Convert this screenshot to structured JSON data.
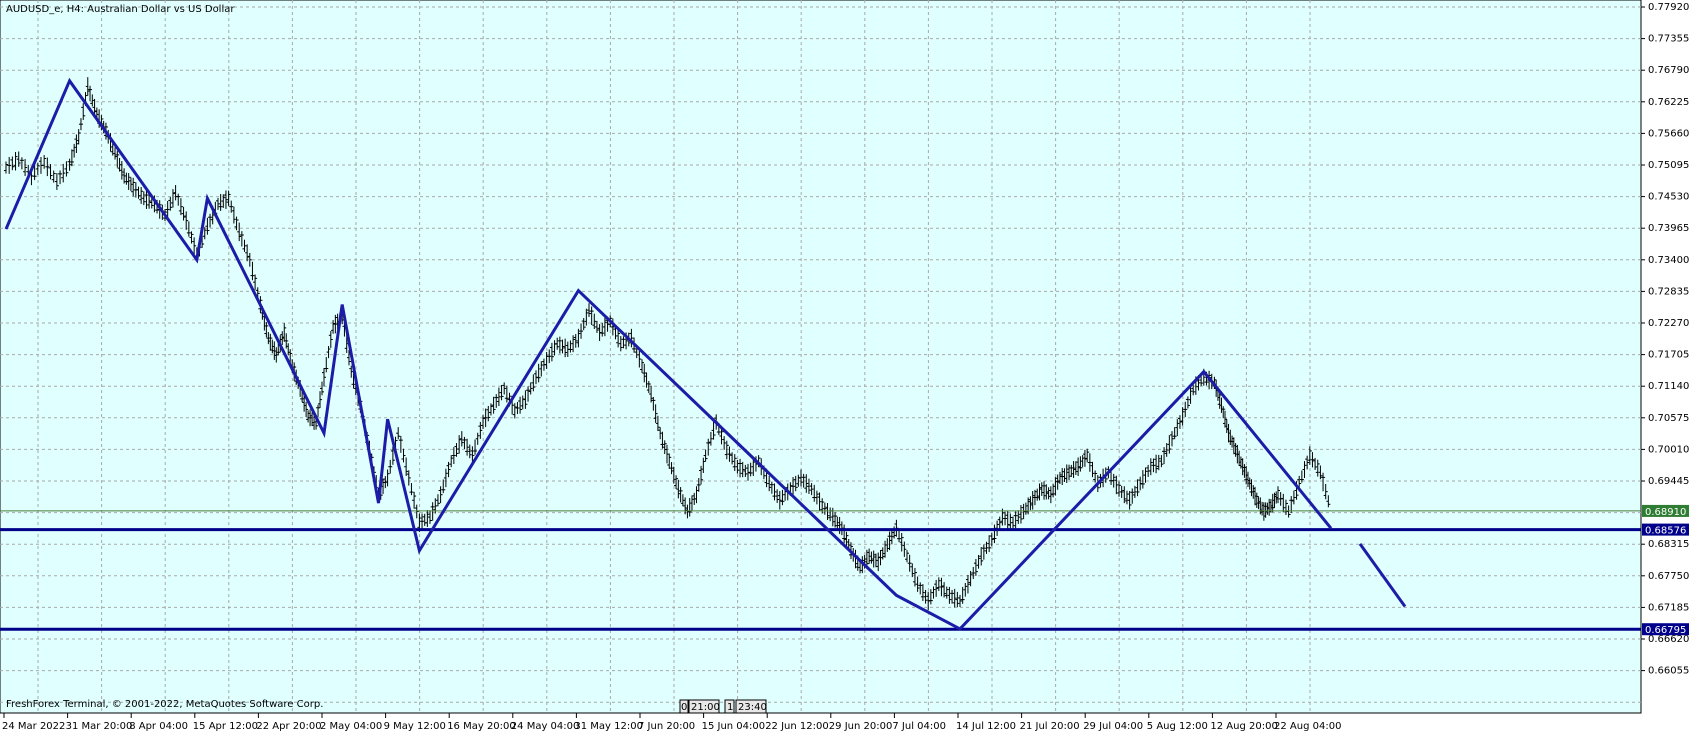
{
  "window": {
    "title": "AUDUSD_e, H4:  Australian Dollar vs US Dollar",
    "copyright": "FreshForex Terminal, © 2001-2022, MetaQuotes Software Corp.",
    "scroll_markers": [
      "0",
      "21:00",
      "1",
      "23:40"
    ]
  },
  "colors": {
    "background": "#e0ffff",
    "grid": "#a9a9a9",
    "candles": "#000000",
    "zigzag": "#1c1ca8",
    "level_line": "#00008b",
    "bid_line": "#4a7f3a",
    "bid_label": "#2e7d32",
    "level_label": "#00008b"
  },
  "price_axis": {
    "ticks": [
      "0.77920",
      "0.77355",
      "0.76790",
      "0.76225",
      "0.75660",
      "0.75095",
      "0.74530",
      "0.73965",
      "0.73400",
      "0.72835",
      "0.72270",
      "0.71705",
      "0.71140",
      "0.70575",
      "0.70010",
      "0.69445",
      "0.68315",
      "0.67750",
      "0.67185",
      "0.66620",
      "0.66055"
    ],
    "bid_label": "0.68910",
    "level_labels": [
      "0.68576",
      "0.66795"
    ]
  },
  "time_axis": {
    "labels": [
      "24 Mar 2022",
      "31 Mar 20:00",
      "8 Apr 04:00",
      "15 Apr 12:00",
      "22 Apr 20:00",
      "2 May 04:00",
      "9 May 12:00",
      "16 May 20:00",
      "24 May 04:00",
      "31 May 12:00",
      "7 Jun 20:00",
      "15 Jun 04:00",
      "22 Jun 12:00",
      "29 Jun 20:00",
      "7 Jul 04:00",
      "14 Jul 12:00",
      "21 Jul 20:00",
      "29 Jul 04:00",
      "5 Aug 12:00",
      "12 Aug 20:00",
      "22 Aug 04:00"
    ]
  },
  "chart_data": {
    "type": "line",
    "symbol": "AUDUSD_e",
    "timeframe": "H4",
    "description": "Australian Dollar vs US Dollar",
    "ylim": [
      0.6605,
      0.7795
    ],
    "current_bid": 0.6891,
    "horizontal_levels": [
      0.68576,
      0.66795
    ],
    "price_path": [
      [
        "24 Mar 2022",
        0.7505
      ],
      [
        "26 Mar",
        0.752
      ],
      [
        "28 Mar",
        0.749
      ],
      [
        "29 Mar",
        0.7515
      ],
      [
        "30 Mar",
        0.748
      ],
      [
        "31 Mar 20:00",
        0.751
      ],
      [
        "1 Apr",
        0.756
      ],
      [
        "2 Apr",
        0.765
      ],
      [
        "4 Apr",
        0.76
      ],
      [
        "5 Apr",
        0.757
      ],
      [
        "6 Apr",
        0.753
      ],
      [
        "7 Apr",
        0.749
      ],
      [
        "8 Apr 04:00",
        0.747
      ],
      [
        "9 Apr",
        0.745
      ],
      [
        "11 Apr",
        0.744
      ],
      [
        "12 Apr",
        0.742
      ],
      [
        "13 Apr",
        0.746
      ],
      [
        "14 Apr",
        0.741
      ],
      [
        "15 Apr 12:00",
        0.735
      ],
      [
        "17 Apr",
        0.74
      ],
      [
        "18 Apr",
        0.744
      ],
      [
        "19 Apr",
        0.745
      ],
      [
        "20 Apr",
        0.739
      ],
      [
        "21 Apr",
        0.734
      ],
      [
        "22 Apr 20:00",
        0.726
      ],
      [
        "24 Apr",
        0.72
      ],
      [
        "25 Apr",
        0.717
      ],
      [
        "26 Apr",
        0.721
      ],
      [
        "27 Apr",
        0.715
      ],
      [
        "28 Apr",
        0.711
      ],
      [
        "29 Apr",
        0.706
      ],
      [
        "30 Apr",
        0.705
      ],
      [
        "2 May 04:00",
        0.713
      ],
      [
        "3 May",
        0.722
      ],
      [
        "4 May",
        0.724
      ],
      [
        "5 May",
        0.714
      ],
      [
        "6 May",
        0.708
      ],
      [
        "7 May",
        0.7
      ],
      [
        "8 May",
        0.692
      ],
      [
        "9 May 12:00",
        0.695
      ],
      [
        "10 May",
        0.703
      ],
      [
        "11 May",
        0.695
      ],
      [
        "12 May",
        0.687
      ],
      [
        "13 May",
        0.688
      ],
      [
        "14 May",
        0.692
      ],
      [
        "16 May 20:00",
        0.698
      ],
      [
        "18 May",
        0.702
      ],
      [
        "19 May",
        0.699
      ],
      [
        "20 May",
        0.705
      ],
      [
        "21 May",
        0.708
      ],
      [
        "23 May",
        0.711
      ],
      [
        "24 May 04:00",
        0.707
      ],
      [
        "25 May",
        0.709
      ],
      [
        "26 May",
        0.713
      ],
      [
        "27 May",
        0.716
      ],
      [
        "28 May",
        0.719
      ],
      [
        "30 May",
        0.718
      ],
      [
        "31 May 12:00",
        0.72
      ],
      [
        "1 Jun",
        0.725
      ],
      [
        "2 Jun",
        0.721
      ],
      [
        "3 Jun",
        0.723
      ],
      [
        "4 Jun",
        0.719
      ],
      [
        "6 Jun",
        0.72
      ],
      [
        "7 Jun 20:00",
        0.715
      ],
      [
        "8 Jun",
        0.71
      ],
      [
        "9 Jun",
        0.703
      ],
      [
        "10 Jun",
        0.698
      ],
      [
        "11 Jun",
        0.693
      ],
      [
        "13 Jun",
        0.689
      ],
      [
        "14 Jun",
        0.692
      ],
      [
        "15 Jun 04:00",
        0.699
      ],
      [
        "16 Jun",
        0.705
      ],
      [
        "17 Jun",
        0.7
      ],
      [
        "18 Jun",
        0.697
      ],
      [
        "20 Jun",
        0.696
      ],
      [
        "21 Jun",
        0.698
      ],
      [
        "22 Jun 12:00",
        0.694
      ],
      [
        "23 Jun",
        0.691
      ],
      [
        "24 Jun",
        0.693
      ],
      [
        "25 Jun",
        0.695
      ],
      [
        "27 Jun",
        0.693
      ],
      [
        "28 Jun",
        0.69
      ],
      [
        "29 Jun 20:00",
        0.688
      ],
      [
        "30 Jun",
        0.686
      ],
      [
        "1 Jul",
        0.682
      ],
      [
        "2 Jul",
        0.679
      ],
      [
        "4 Jul",
        0.681
      ],
      [
        "5 Jul",
        0.68
      ],
      [
        "6 Jul",
        0.683
      ],
      [
        "7 Jul 04:00",
        0.686
      ],
      [
        "8 Jul",
        0.681
      ],
      [
        "9 Jul",
        0.676
      ],
      [
        "11 Jul",
        0.673
      ],
      [
        "12 Jul",
        0.676
      ],
      [
        "13 Jul",
        0.674
      ],
      [
        "14 Jul 12:00",
        0.673
      ],
      [
        "15 Jul",
        0.677
      ],
      [
        "16 Jul",
        0.681
      ],
      [
        "18 Jul",
        0.684
      ],
      [
        "19 Jul",
        0.688
      ],
      [
        "20 Jul",
        0.687
      ],
      [
        "21 Jul 20:00",
        0.689
      ],
      [
        "22 Jul",
        0.691
      ],
      [
        "23 Jul",
        0.693
      ],
      [
        "25 Jul",
        0.692
      ],
      [
        "26 Jul",
        0.695
      ],
      [
        "27 Jul",
        0.696
      ],
      [
        "28 Jul",
        0.697
      ],
      [
        "29 Jul 04:00",
        0.699
      ],
      [
        "30 Jul",
        0.694
      ],
      [
        "1 Aug",
        0.696
      ],
      [
        "2 Aug",
        0.693
      ],
      [
        "3 Aug",
        0.691
      ],
      [
        "4 Aug",
        0.694
      ],
      [
        "5 Aug 12:00",
        0.697
      ],
      [
        "6 Aug",
        0.698
      ],
      [
        "8 Aug",
        0.702
      ],
      [
        "9 Aug",
        0.706
      ],
      [
        "10 Aug",
        0.711
      ],
      [
        "11 Aug",
        0.713
      ],
      [
        "12 Aug 20:00",
        0.712
      ],
      [
        "13 Aug",
        0.708
      ],
      [
        "15 Aug",
        0.703
      ],
      [
        "16 Aug",
        0.7
      ],
      [
        "17 Aug",
        0.697
      ],
      [
        "18 Aug",
        0.694
      ],
      [
        "19 Aug",
        0.691
      ],
      [
        "20 Aug",
        0.689
      ],
      [
        "21 Aug",
        0.69
      ],
      [
        "22 Aug 04:00",
        0.692
      ],
      [
        "23 Aug",
        0.689
      ],
      [
        "24 Aug",
        0.694
      ],
      [
        "25 Aug",
        0.699
      ],
      [
        "26 Aug",
        0.696
      ],
      [
        "27 Aug",
        0.6891
      ]
    ],
    "zigzag": [
      [
        "24 Mar 2022",
        0.7395
      ],
      [
        "31 Mar 20:00",
        0.766
      ],
      [
        "15 Apr 12:00",
        0.734
      ],
      [
        "17 Apr",
        0.745
      ],
      [
        "2 May 04:00",
        0.703
      ],
      [
        "4 May",
        0.726
      ],
      [
        "8 May",
        0.6905
      ],
      [
        "9 May 12:00",
        0.7055
      ],
      [
        "12 May",
        0.682
      ],
      [
        "31 May 12:00",
        0.7285
      ],
      [
        "7 Jul 04:00",
        0.674
      ],
      [
        "14 Jul 12:00",
        0.668
      ],
      [
        "11 Aug",
        0.714
      ],
      [
        "27 Aug",
        0.686
      ]
    ],
    "projection": [
      [
        "28 Aug",
        0.6832
      ],
      [
        "31 Aug",
        0.672
      ]
    ]
  }
}
